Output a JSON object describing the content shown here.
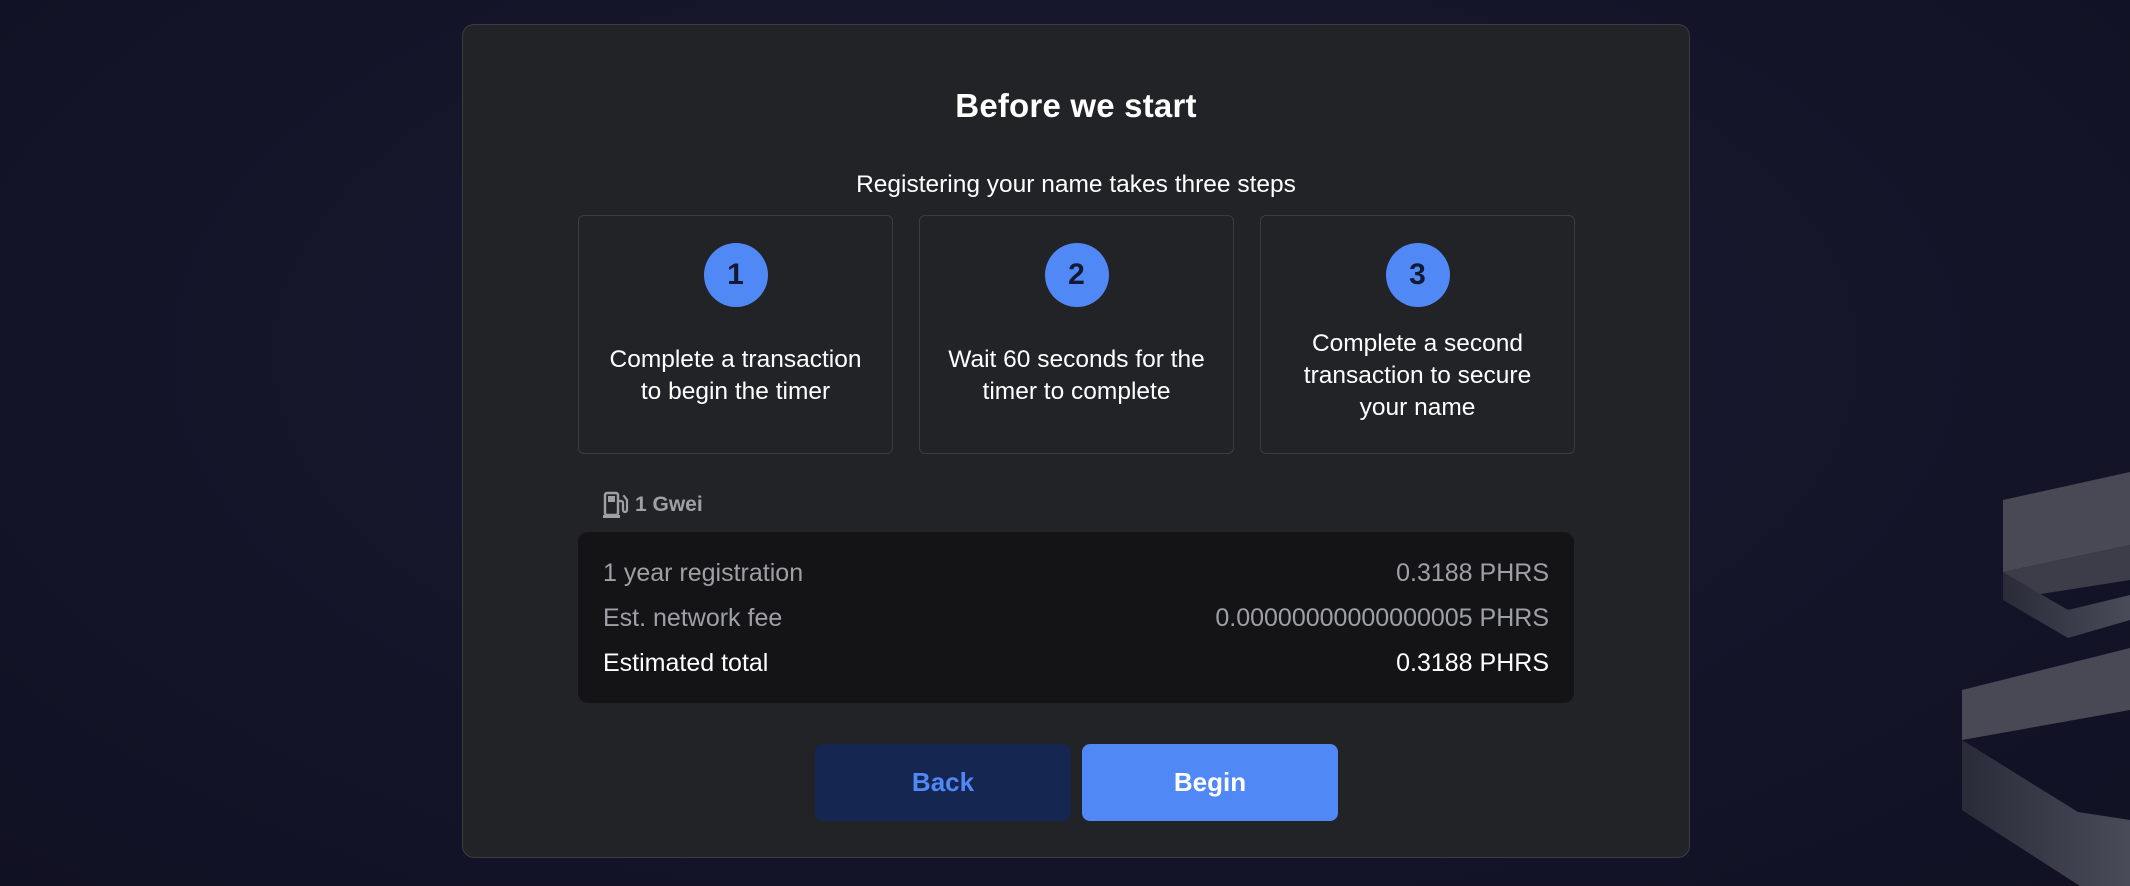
{
  "dialog": {
    "title": "Before we start",
    "subtitle": "Registering your name takes three steps"
  },
  "steps": [
    {
      "number": "1",
      "text": "Complete a transaction to begin the timer"
    },
    {
      "number": "2",
      "text": "Wait 60 seconds for the timer to complete"
    },
    {
      "number": "3",
      "text": "Complete a second transaction to secure your name"
    }
  ],
  "gas": {
    "icon": "gas-pump-icon",
    "price": "1 Gwei"
  },
  "summary": {
    "registration_label": "1 year registration",
    "registration_value": "0.3188 PHRS",
    "fee_label": "Est. network fee",
    "fee_value": "0.00000000000000005 PHRS",
    "total_label": "Estimated total",
    "total_value": "0.3188 PHRS"
  },
  "actions": {
    "back_label": "Back",
    "begin_label": "Begin"
  },
  "colors": {
    "accent": "#5088f6",
    "card_background": "#222326",
    "summary_background": "#141416",
    "back_button_background": "#152751"
  }
}
